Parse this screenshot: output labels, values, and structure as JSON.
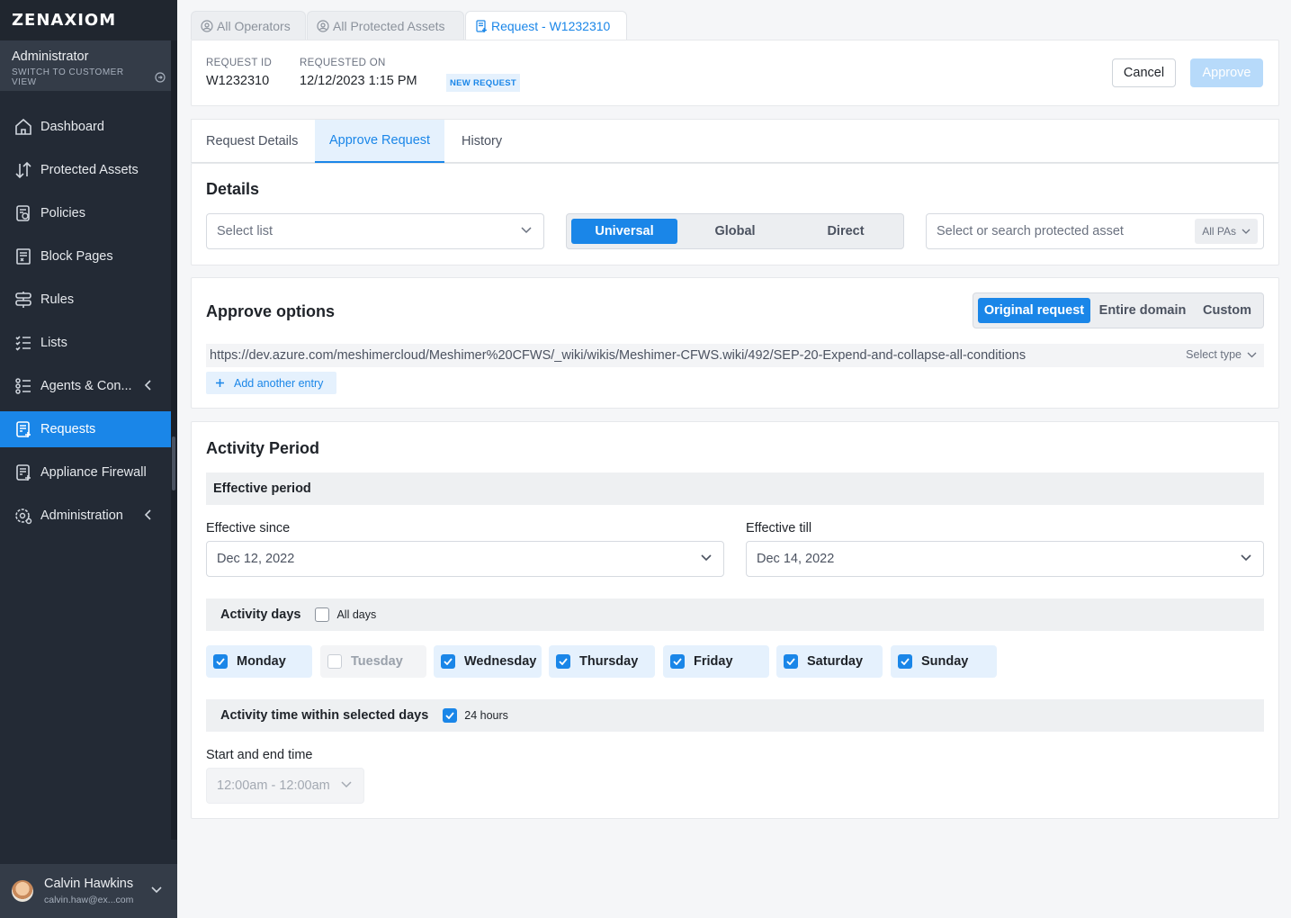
{
  "brand": {
    "logo_text": "ZENAXIOM"
  },
  "account": {
    "role": "Administrator",
    "switch_label": "SWITCH TO CUSTOMER VIEW"
  },
  "nav": {
    "items": [
      {
        "label": "Dashboard",
        "icon": "home-icon"
      },
      {
        "label": "Protected Assets",
        "icon": "arrows-updown-icon"
      },
      {
        "label": "Policies",
        "icon": "policy-icon"
      },
      {
        "label": "Block Pages",
        "icon": "block-page-icon"
      },
      {
        "label": "Rules",
        "icon": "signpost-icon"
      },
      {
        "label": "Lists",
        "icon": "checklist-icon"
      },
      {
        "label": "Agents & Con...",
        "icon": "agents-icon"
      },
      {
        "label": "Requests",
        "icon": "request-icon",
        "active": true
      },
      {
        "label": "Appliance Firewall",
        "icon": "firewall-icon"
      },
      {
        "label": "Administration",
        "icon": "gear-user-icon"
      }
    ]
  },
  "user": {
    "name": "Calvin Hawkins",
    "email": "calvin.haw@ex...com"
  },
  "tabs": [
    {
      "label": "All Operators"
    },
    {
      "label": "All Protected Assets"
    },
    {
      "label": "Request - W1232310",
      "active": true
    }
  ],
  "header": {
    "request_id_label": "REQUEST ID",
    "request_id": "W1232310",
    "requested_on_label": "REQUESTED ON",
    "requested_on": "12/12/2023 1:15 PM",
    "status_badge": "NEW REQUEST",
    "cancel_label": "Cancel",
    "approve_label": "Approve"
  },
  "subtabs": [
    {
      "label": "Request Details"
    },
    {
      "label": "Approve Request",
      "active": true
    },
    {
      "label": "History"
    }
  ],
  "details": {
    "title": "Details",
    "list_placeholder": "Select list",
    "scope_options": [
      "Universal",
      "Global",
      "Direct"
    ],
    "scope_selected": "Universal",
    "asset_placeholder": "Select or search protected asset",
    "asset_filter": "All PAs"
  },
  "approve_options": {
    "title": "Approve options",
    "modes": [
      "Original request",
      "Entire domain",
      "Custom"
    ],
    "mode_selected": "Original request",
    "entry_url": "https://dev.azure.com/meshimercloud/Meshimer%20CFWS/_wiki/wikis/Meshimer-CFWS.wiki/492/SEP-20-Expend-and-collapse-all-conditions",
    "entry_type_placeholder": "Select type",
    "add_entry_label": "Add another entry"
  },
  "activity": {
    "title": "Activity Period",
    "effective_header": "Effective period",
    "since_label": "Effective since",
    "since_value": "Dec 12, 2022",
    "till_label": "Effective till",
    "till_value": "Dec 14, 2022",
    "days_header": "Activity days",
    "all_days_label": "All days",
    "days": [
      {
        "label": "Monday",
        "checked": true
      },
      {
        "label": "Tuesday",
        "checked": false
      },
      {
        "label": "Wednesday",
        "checked": true
      },
      {
        "label": "Thursday",
        "checked": true
      },
      {
        "label": "Friday",
        "checked": true
      },
      {
        "label": "Saturday",
        "checked": true
      },
      {
        "label": "Sunday",
        "checked": true
      }
    ],
    "time_header": "Activity time within selected days",
    "hours_label": "24 hours",
    "time_label": "Start and end time",
    "time_value": "12:00am - 12:00am"
  },
  "colors": {
    "accent": "#1a86e8",
    "sidebar": "#232a35",
    "approve_disabled": "#b7dafa"
  }
}
